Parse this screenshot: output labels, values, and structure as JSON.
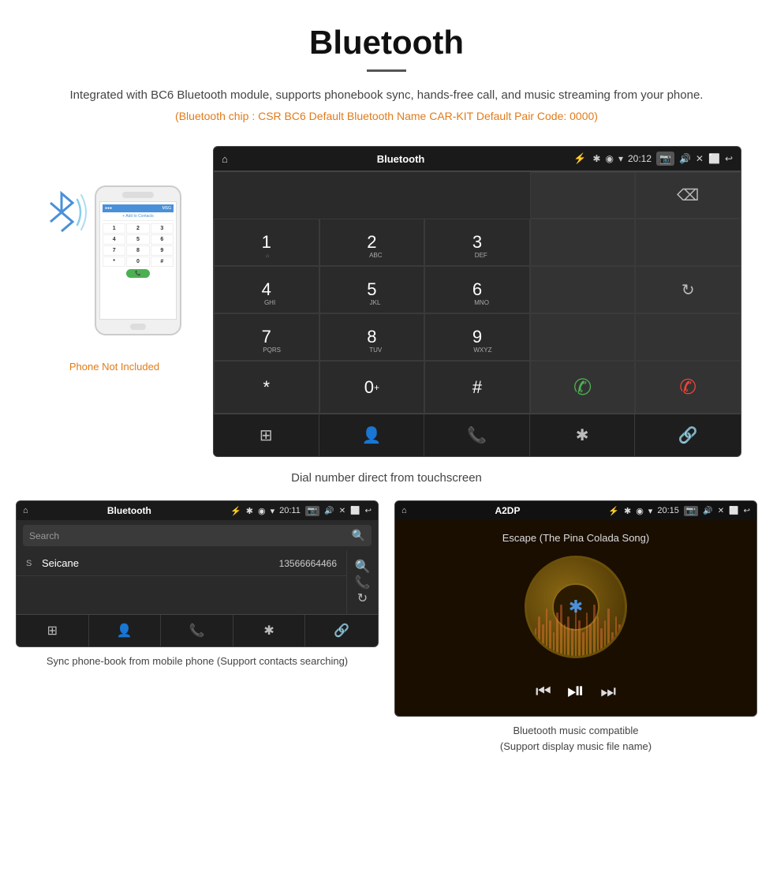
{
  "header": {
    "title": "Bluetooth",
    "description": "Integrated with BC6 Bluetooth module, supports phonebook sync, hands-free call, and music streaming from your phone.",
    "specs": "(Bluetooth chip : CSR BC6    Default Bluetooth Name CAR-KIT    Default Pair Code: 0000)"
  },
  "dialScreen": {
    "title": "Bluetooth",
    "time": "20:12",
    "keys": [
      {
        "main": "1",
        "sub": ""
      },
      {
        "main": "2",
        "sub": "ABC"
      },
      {
        "main": "3",
        "sub": "DEF"
      },
      {
        "main": "",
        "sub": ""
      },
      {
        "main": "⌫",
        "sub": ""
      },
      {
        "main": "4",
        "sub": "GHI"
      },
      {
        "main": "5",
        "sub": "JKL"
      },
      {
        "main": "6",
        "sub": "MNO"
      },
      {
        "main": "",
        "sub": ""
      },
      {
        "main": "",
        "sub": ""
      },
      {
        "main": "7",
        "sub": "PQRS"
      },
      {
        "main": "8",
        "sub": "TUV"
      },
      {
        "main": "9",
        "sub": "WXYZ"
      },
      {
        "main": "",
        "sub": ""
      },
      {
        "main": "↻",
        "sub": ""
      },
      {
        "main": "*",
        "sub": ""
      },
      {
        "main": "0",
        "sub": "+"
      },
      {
        "main": "#",
        "sub": ""
      },
      {
        "main": "📞",
        "sub": "",
        "green": true
      },
      {
        "main": "📵",
        "sub": "",
        "red": true
      }
    ],
    "bottomIcons": [
      "⊞",
      "👤",
      "📞",
      "✱",
      "🔗"
    ],
    "caption": "Dial number direct from touchscreen"
  },
  "phonebookScreen": {
    "title": "Bluetooth",
    "time": "20:11",
    "searchPlaceholder": "Search",
    "contacts": [
      {
        "letter": "S",
        "name": "Seicane",
        "number": "13566664466"
      }
    ],
    "bottomIcons": [
      "⊞",
      "👤",
      "📞",
      "✱",
      "🔗"
    ],
    "caption": "Sync phone-book from mobile phone\n(Support contacts searching)"
  },
  "musicScreen": {
    "title": "A2DP",
    "time": "20:15",
    "songName": "Escape (The Pina Colada Song)",
    "controls": [
      "⏮",
      "⏯",
      "⏭"
    ],
    "caption": "Bluetooth music compatible\n(Support display music file name)"
  },
  "phoneNotIncluded": "Phone Not Included",
  "eqBars": [
    20,
    35,
    50,
    40,
    60,
    45,
    30,
    55,
    65,
    40,
    50,
    35,
    60,
    45,
    30,
    55,
    40,
    65,
    50,
    35,
    45,
    60,
    30,
    50,
    40
  ]
}
